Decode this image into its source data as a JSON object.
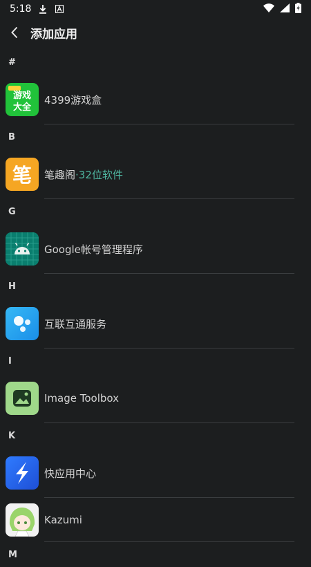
{
  "status_bar": {
    "time": "5:18",
    "icons": [
      "download-icon",
      "a-notification-icon",
      "wifi-icon",
      "signal-icon",
      "battery-icon"
    ]
  },
  "topbar": {
    "back_icon": "chevron-left-icon",
    "title": "添加应用"
  },
  "sections": [
    {
      "letter": "#",
      "apps": [
        {
          "name": "4399游戏盒",
          "icon": "4399-game-box-icon"
        }
      ]
    },
    {
      "letter": "B",
      "apps": [
        {
          "name": "笔趣阁",
          "suffix": "·32位软件",
          "icon": "biquge-icon"
        }
      ]
    },
    {
      "letter": "G",
      "apps": [
        {
          "name": "Google帐号管理程序",
          "icon": "android-robot-icon"
        }
      ]
    },
    {
      "letter": "H",
      "apps": [
        {
          "name": "互联互通服务",
          "icon": "interconnect-dots-icon"
        }
      ]
    },
    {
      "letter": "I",
      "apps": [
        {
          "name": "Image Toolbox",
          "icon": "image-toolbox-icon"
        }
      ]
    },
    {
      "letter": "K",
      "apps": [
        {
          "name": "快应用中心",
          "icon": "quick-app-bolt-icon"
        },
        {
          "name": "Kazumi",
          "icon": "kazumi-anime-icon"
        }
      ]
    },
    {
      "letter": "M",
      "apps": []
    }
  ],
  "colors": {
    "background": "#1c1e1f",
    "accent": "#4fb6a0",
    "divider": "#3a3d3f"
  }
}
